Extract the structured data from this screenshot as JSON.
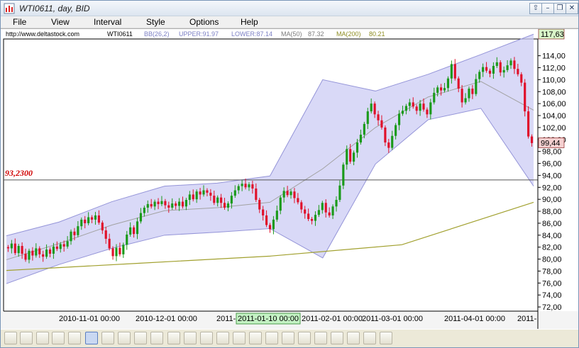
{
  "window": {
    "title": "WTI0611, day, BID",
    "buttons": [
      "⇧",
      "–",
      "❐",
      "✕"
    ]
  },
  "menu": [
    "File",
    "View",
    "Interval",
    "Style",
    "Options",
    "Help"
  ],
  "infobar": {
    "url": "http://www.deltastock.com",
    "symbol": "WTI0611",
    "bb": "BB(26,2)",
    "upper": "UPPER:91.97",
    "lower": "LOWER:87.14",
    "ma50_label": "MA(50)",
    "ma50_value": "87.32",
    "ma200_label": "MA(200)",
    "ma200_value": "80.21"
  },
  "colors": {
    "up_candle": "#1a9a1a",
    "down_candle": "#e0102a",
    "band_fill": "#ccccf4",
    "band_line": "#9494d8",
    "ma50": "#a2a2a2",
    "ma200": "#a1a02e",
    "hline": "#555555",
    "hline_label": "#d00000"
  },
  "chart_data": {
    "type": "candlestick",
    "y_axis_ticks": [
      "72,00",
      "74,00",
      "76,00",
      "78,00",
      "80,00",
      "82,00",
      "84,00",
      "86,00",
      "88,00",
      "90,00",
      "92,00",
      "94,00",
      "96,00",
      "98,00",
      "100,00",
      "102,00",
      "104,00",
      "106,00",
      "108,00",
      "110,00",
      "112,00",
      "114,00"
    ],
    "ylim": [
      71.3,
      116.8
    ],
    "x_labels": [
      "2010-11-01 00:00",
      "2010-12-01 00:00",
      "2011-01-10 00:00",
      "2011-02-01 00:00",
      "2011-03-01 00:00",
      "2011-04-01 00:00"
    ],
    "x_label_edges": [
      "2011-",
      "2011-"
    ],
    "x_label_highlight": "2011-01-10 00:00",
    "price_top": "117,63",
    "price_current": "99,44",
    "horizontal_line": {
      "value": 93.23,
      "label": "93,2300"
    },
    "ohlc_start_close": 82.0,
    "candle_closes": [
      81.8,
      82.6,
      81.0,
      82.2,
      80.9,
      79.9,
      81.4,
      80.6,
      81.8,
      80.8,
      80.4,
      81.6,
      80.9,
      82.1,
      81.7,
      82.5,
      82.1,
      83.0,
      84.6,
      84.0,
      85.5,
      86.6,
      86.0,
      87.0,
      86.6,
      87.3,
      86.1,
      84.8,
      83.4,
      81.8,
      80.5,
      81.9,
      80.8,
      82.4,
      84.1,
      85.3,
      84.2,
      86.3,
      87.7,
      88.6,
      89.2,
      88.8,
      89.6,
      89.2,
      89.7,
      89.0,
      88.6,
      89.3,
      88.9,
      89.6,
      88.8,
      89.9,
      90.8,
      90.0,
      91.3,
      90.8,
      91.5,
      91.1,
      90.6,
      89.4,
      90.3,
      89.4,
      88.6,
      89.3,
      90.6,
      91.5,
      92.2,
      92.6,
      92.0,
      92.5,
      91.8,
      89.9,
      88.3,
      87.3,
      85.7,
      85.0,
      86.6,
      88.1,
      90.3,
      91.4,
      90.7,
      91.3,
      90.2,
      89.5,
      88.3,
      87.6,
      86.7,
      86.4,
      87.4,
      88.2,
      89.4,
      87.8,
      87.3,
      88.8,
      89.9,
      92.3,
      95.8,
      98.4,
      96.3,
      97.8,
      99.5,
      100.8,
      102.6,
      104.7,
      106.0,
      104.2,
      103.2,
      102.0,
      99.5,
      98.6,
      100.6,
      102.4,
      104.3,
      104.8,
      105.6,
      106.2,
      105.5,
      104.8,
      106.0,
      105.0,
      104.2,
      106.2,
      107.8,
      108.7,
      108.2,
      108.6,
      110.2,
      112.6,
      110.2,
      108.5,
      106.2,
      106.9,
      108.5,
      107.6,
      110.1,
      111.3,
      112.1,
      111.5,
      111.0,
      112.3,
      112.9,
      111.2,
      111.6,
      112.4,
      113.2,
      111.8,
      110.9,
      109.5,
      104.7,
      100.5,
      99.4
    ],
    "bollinger": {
      "mid": [
        [
          0,
          79.9
        ],
        [
          40,
          82.6
        ],
        [
          80,
          85.7
        ],
        [
          120,
          88.1
        ],
        [
          160,
          88.6
        ],
        [
          200,
          89.5
        ],
        [
          240,
          95.1
        ],
        [
          280,
          102.0
        ],
        [
          320,
          107.1
        ],
        [
          360,
          109.7
        ],
        [
          400,
          104.9
        ]
      ],
      "upper": [
        [
          0,
          83.9
        ],
        [
          40,
          86.2
        ],
        [
          80,
          89.6
        ],
        [
          120,
          92.2
        ],
        [
          160,
          92.7
        ],
        [
          200,
          93.9
        ],
        [
          240,
          110.0
        ],
        [
          280,
          108.1
        ],
        [
          320,
          110.9
        ],
        [
          360,
          114.2
        ],
        [
          400,
          117.6
        ]
      ],
      "lower": [
        [
          0,
          75.9
        ],
        [
          40,
          79.1
        ],
        [
          80,
          81.8
        ],
        [
          120,
          84.0
        ],
        [
          160,
          84.5
        ],
        [
          200,
          85.1
        ],
        [
          240,
          80.2
        ],
        [
          280,
          95.9
        ],
        [
          320,
          103.3
        ],
        [
          360,
          105.2
        ],
        [
          400,
          92.2
        ]
      ]
    },
    "ma200": [
      [
        0,
        78.1
      ],
      [
        100,
        79.3
      ],
      [
        200,
        80.5
      ],
      [
        300,
        82.4
      ],
      [
        400,
        89.5
      ]
    ]
  }
}
